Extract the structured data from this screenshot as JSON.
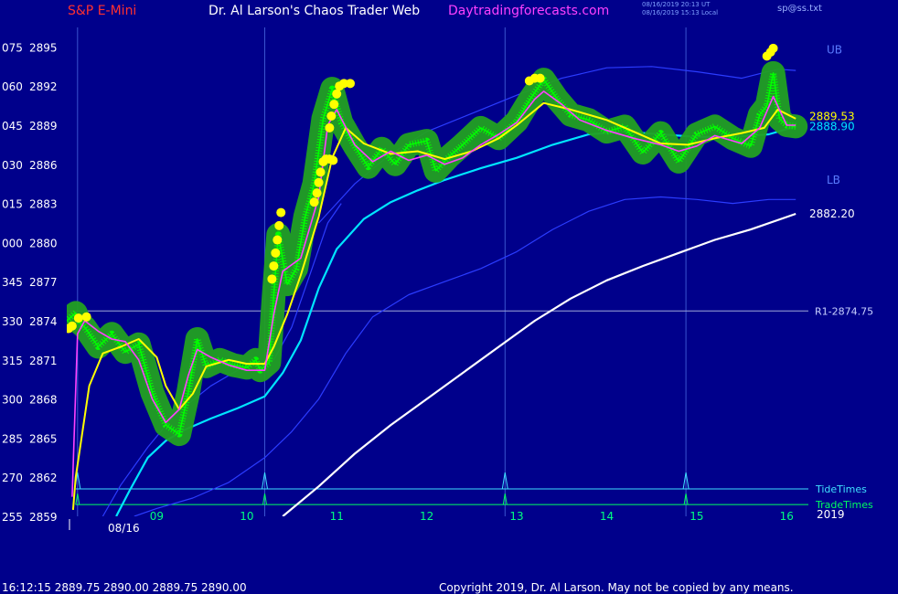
{
  "header": {
    "symbol": "S&P E-Mini",
    "title": "Dr. Al Larson's Chaos Trader Web",
    "site": "Daytradingforecasts.com",
    "time_ut": "08/16/2019 20:13 UT",
    "time_local": "08/16/2019 15:13 Local",
    "file": "sp@ss.txt"
  },
  "footer": {
    "quote": "16:12:15  2889.75 2890.00 2889.75 2890.00",
    "copyright": "Copyright 2019, Dr. Al Larson. May not be copied by any means."
  },
  "colors": {
    "background": "#00008b",
    "price": "#00ff00",
    "glow": "#22a022",
    "fast_ma": "#ff40ff",
    "slow_ma": "#ffff00",
    "cyan_ma": "#00e5ff",
    "white_ma": "#ffffff",
    "band": "#2b3cff",
    "tide": "#40e0ff",
    "trade": "#00ff60",
    "marker": "#ffff00"
  },
  "chart_data": {
    "type": "line",
    "title": "S&P E-Mini",
    "x_ticks": [
      "09",
      "10",
      "11",
      "12",
      "13",
      "14",
      "15",
      "16"
    ],
    "x_range": [
      8.0,
      16.2
    ],
    "date_label": "08/16",
    "year_label": "2019",
    "ylim": [
      2859,
      2896.5
    ],
    "y_ticks": [
      {
        "price": 2895,
        "degree": "075"
      },
      {
        "price": 2892,
        "degree": "060"
      },
      {
        "price": 2889,
        "degree": "045"
      },
      {
        "price": 2886,
        "degree": "030"
      },
      {
        "price": 2883,
        "degree": "015"
      },
      {
        "price": 2880,
        "degree": "000"
      },
      {
        "price": 2877,
        "degree": "345"
      },
      {
        "price": 2874,
        "degree": "330"
      },
      {
        "price": 2871,
        "degree": "315"
      },
      {
        "price": 2868,
        "degree": "300"
      },
      {
        "price": 2865,
        "degree": "285"
      },
      {
        "price": 2862,
        "degree": "270"
      },
      {
        "price": 2859,
        "degree": "255"
      }
    ],
    "series": [
      {
        "key": "price",
        "x": [
          8.0,
          8.1,
          8.15,
          8.2,
          8.35,
          8.5,
          8.65,
          8.8,
          8.95,
          9.1,
          9.25,
          9.35,
          9.45,
          9.55,
          9.7,
          9.85,
          10.0,
          10.1,
          10.15,
          10.25,
          10.3,
          10.35,
          10.45,
          10.55,
          10.65,
          10.75,
          10.85,
          10.95,
          11.05,
          11.2,
          11.35,
          11.5,
          11.65,
          11.8,
          12.0,
          12.1,
          12.25,
          12.4,
          12.6,
          12.8,
          13.0,
          13.15,
          13.3,
          13.45,
          13.6,
          13.8,
          14.0,
          14.2,
          14.4,
          14.6,
          14.8,
          15.0,
          15.2,
          15.4,
          15.6,
          15.7,
          15.78,
          15.85,
          15.92,
          16.0,
          16.1
        ],
        "values": [
          2874.0,
          2874.6,
          2873.8,
          2873.5,
          2872.0,
          2873.0,
          2871.6,
          2872.2,
          2868.5,
          2866.0,
          2865.3,
          2868.5,
          2872.6,
          2870.5,
          2871.0,
          2870.6,
          2870.4,
          2871.0,
          2870.2,
          2870.8,
          2876.0,
          2880.6,
          2876.8,
          2878.0,
          2882.0,
          2884.5,
          2889.5,
          2891.8,
          2889.2,
          2887.4,
          2885.8,
          2887.2,
          2886.0,
          2887.5,
          2887.8,
          2885.5,
          2886.6,
          2887.5,
          2888.8,
          2888.0,
          2889.3,
          2891.0,
          2892.5,
          2891.0,
          2889.8,
          2889.4,
          2888.5,
          2888.9,
          2886.9,
          2888.4,
          2886.2,
          2888.3,
          2888.9,
          2888.0,
          2887.4,
          2889.8,
          2890.5,
          2893.0,
          2889.5,
          2889.0,
          2888.9
        ]
      },
      {
        "key": "fast_ma",
        "x": [
          8.06,
          8.12,
          8.2,
          8.35,
          8.5,
          8.65,
          8.8,
          8.95,
          9.1,
          9.25,
          9.35,
          9.45,
          9.6,
          9.8,
          10.0,
          10.2,
          10.3,
          10.4,
          10.6,
          10.8,
          10.9,
          11.0,
          11.2,
          11.4,
          11.6,
          11.8,
          12.0,
          12.2,
          12.4,
          12.6,
          12.8,
          13.0,
          13.2,
          13.3,
          13.5,
          13.7,
          14.0,
          14.3,
          14.6,
          14.8,
          15.0,
          15.2,
          15.5,
          15.7,
          15.85,
          16.0,
          16.1
        ],
        "values": [
          2860.5,
          2873.0,
          2874.0,
          2873.2,
          2872.6,
          2872.4,
          2871.0,
          2868.0,
          2866.2,
          2867.2,
          2869.8,
          2871.8,
          2871.2,
          2870.6,
          2870.2,
          2870.2,
          2874.5,
          2877.8,
          2878.8,
          2883.5,
          2889.0,
          2890.2,
          2887.5,
          2886.2,
          2887.0,
          2886.3,
          2886.7,
          2886.0,
          2886.5,
          2887.5,
          2888.3,
          2889.2,
          2891.0,
          2891.6,
          2890.6,
          2889.4,
          2888.6,
          2888.0,
          2887.5,
          2887.0,
          2887.4,
          2888.2,
          2887.6,
          2888.8,
          2891.2,
          2889.0,
          2889.0
        ]
      },
      {
        "key": "slow_ma",
        "x": [
          8.07,
          8.1,
          8.25,
          8.4,
          8.6,
          8.8,
          9.0,
          9.1,
          9.25,
          9.4,
          9.55,
          9.8,
          10.0,
          10.2,
          10.3,
          10.45,
          10.6,
          10.8,
          10.95,
          11.1,
          11.3,
          11.6,
          11.9,
          12.2,
          12.5,
          12.8,
          13.0,
          13.3,
          13.6,
          14.0,
          14.3,
          14.6,
          14.9,
          15.2,
          15.5,
          15.75,
          15.9,
          16.1
        ],
        "values": [
          2859.5,
          2862.0,
          2869.0,
          2871.5,
          2872.0,
          2872.6,
          2871.2,
          2869.0,
          2867.2,
          2868.4,
          2870.5,
          2871.0,
          2870.7,
          2870.7,
          2872.0,
          2874.5,
          2877.5,
          2882.0,
          2886.5,
          2888.8,
          2887.6,
          2886.8,
          2887.0,
          2886.4,
          2887.0,
          2888.0,
          2889.0,
          2890.7,
          2890.2,
          2889.4,
          2888.5,
          2887.6,
          2887.5,
          2888.0,
          2888.4,
          2888.8,
          2890.2,
          2889.5
        ]
      },
      {
        "key": "cyan_ma",
        "x": [
          8.55,
          8.7,
          8.9,
          9.1,
          9.3,
          9.6,
          9.9,
          10.2,
          10.4,
          10.6,
          10.8,
          11.0,
          11.3,
          11.6,
          11.9,
          12.2,
          12.6,
          13.0,
          13.4,
          13.8,
          14.2,
          14.6,
          15.0,
          15.4,
          15.8,
          16.1
        ],
        "values": [
          2859.0,
          2861.0,
          2863.5,
          2864.8,
          2865.6,
          2866.5,
          2867.3,
          2868.2,
          2870.0,
          2872.5,
          2876.5,
          2879.5,
          2881.8,
          2883.1,
          2884.0,
          2884.8,
          2885.7,
          2886.5,
          2887.5,
          2888.3,
          2888.5,
          2888.3,
          2888.1,
          2888.1,
          2888.3,
          2888.9
        ]
      },
      {
        "key": "white_ma",
        "x": [
          10.4,
          10.8,
          11.2,
          11.6,
          12.0,
          12.4,
          12.8,
          13.2,
          13.6,
          14.0,
          14.4,
          14.8,
          15.2,
          15.6,
          16.1
        ],
        "values": [
          2859.0,
          2861.3,
          2863.8,
          2866.0,
          2868.0,
          2870.0,
          2872.0,
          2874.0,
          2875.7,
          2877.1,
          2878.2,
          2879.2,
          2880.2,
          2881.0,
          2882.2
        ]
      },
      {
        "key": "band_upper",
        "x": [
          10.8,
          11.2,
          11.6,
          12.0,
          12.5,
          13.0,
          13.5,
          14.0,
          14.5,
          15.0,
          15.5,
          15.9,
          16.1
        ],
        "values": [
          2881.5,
          2884.5,
          2886.8,
          2888.5,
          2889.9,
          2891.3,
          2892.6,
          2893.4,
          2893.5,
          2893.1,
          2892.6,
          2893.3,
          2893.2
        ]
      },
      {
        "key": "band_lower",
        "x": [
          8.75,
          9.0,
          9.4,
          9.8,
          10.2,
          10.5,
          10.8,
          11.1,
          11.4,
          11.8,
          12.2,
          12.6,
          13.0,
          13.4,
          13.8,
          14.2,
          14.6,
          15.0,
          15.4,
          15.8,
          16.1
        ],
        "values": [
          2859.0,
          2859.6,
          2860.4,
          2861.6,
          2863.5,
          2865.5,
          2868.0,
          2871.5,
          2874.3,
          2876.0,
          2877.0,
          2878.0,
          2879.3,
          2881.0,
          2882.4,
          2883.3,
          2883.5,
          2883.3,
          2883.0,
          2883.3,
          2883.3
        ]
      },
      {
        "key": "band_inner",
        "x": [
          8.4,
          8.6,
          8.9,
          9.2,
          9.6,
          10.0,
          10.3,
          10.5,
          10.7,
          10.9,
          11.05
        ],
        "values": [
          2859.0,
          2861.4,
          2864.3,
          2866.8,
          2869.0,
          2870.6,
          2871.0,
          2873.5,
          2877.5,
          2881.5,
          2883.0
        ]
      }
    ],
    "markers": [
      {
        "x": 8.02,
        "y": 2873.4
      },
      {
        "x": 8.06,
        "y": 2873.6
      },
      {
        "x": 8.13,
        "y": 2874.2
      },
      {
        "x": 8.22,
        "y": 2874.3
      },
      {
        "x": 10.28,
        "y": 2877.2
      },
      {
        "x": 10.3,
        "y": 2878.2
      },
      {
        "x": 10.32,
        "y": 2879.2
      },
      {
        "x": 10.34,
        "y": 2880.2
      },
      {
        "x": 10.36,
        "y": 2881.3
      },
      {
        "x": 10.38,
        "y": 2882.3
      },
      {
        "x": 10.75,
        "y": 2883.1
      },
      {
        "x": 10.78,
        "y": 2883.8
      },
      {
        "x": 10.8,
        "y": 2884.6
      },
      {
        "x": 10.82,
        "y": 2885.4
      },
      {
        "x": 10.85,
        "y": 2886.2
      },
      {
        "x": 10.88,
        "y": 2886.4
      },
      {
        "x": 10.92,
        "y": 2886.4
      },
      {
        "x": 10.96,
        "y": 2886.3
      },
      {
        "x": 10.92,
        "y": 2888.8
      },
      {
        "x": 10.94,
        "y": 2889.7
      },
      {
        "x": 10.97,
        "y": 2890.6
      },
      {
        "x": 11.0,
        "y": 2891.4
      },
      {
        "x": 11.03,
        "y": 2892.0
      },
      {
        "x": 11.08,
        "y": 2892.2
      },
      {
        "x": 11.15,
        "y": 2892.2
      },
      {
        "x": 13.14,
        "y": 2892.4
      },
      {
        "x": 13.2,
        "y": 2892.6
      },
      {
        "x": 13.26,
        "y": 2892.6
      },
      {
        "x": 15.78,
        "y": 2894.3
      },
      {
        "x": 15.82,
        "y": 2894.6
      },
      {
        "x": 15.85,
        "y": 2894.9
      }
    ],
    "reference_lines": [
      {
        "label": "R1-2874.75",
        "price": 2874.75
      }
    ],
    "band_labels": [
      {
        "text": "UB",
        "price": 2894.5
      },
      {
        "text": "LB",
        "price": 2884.5
      }
    ],
    "last_values": [
      {
        "text": "2889.53",
        "price": 2889.53,
        "color": "#ffff00"
      },
      {
        "text": "2888.90",
        "price": 2888.9,
        "color": "#00e5ff"
      },
      {
        "text": "2882.20",
        "price": 2882.2,
        "color": "#ffffff"
      }
    ],
    "timing_lines": [
      {
        "label": "TideTimes",
        "price": 2861.1,
        "color": "#40e0ff"
      },
      {
        "label": "TradeTimes",
        "price": 2859.9,
        "color": "#00ff60"
      }
    ],
    "timing_spikes": [
      8.12,
      10.2,
      12.87,
      14.88
    ],
    "vertical_markers": [
      8.12,
      10.2,
      12.87,
      14.88
    ]
  }
}
